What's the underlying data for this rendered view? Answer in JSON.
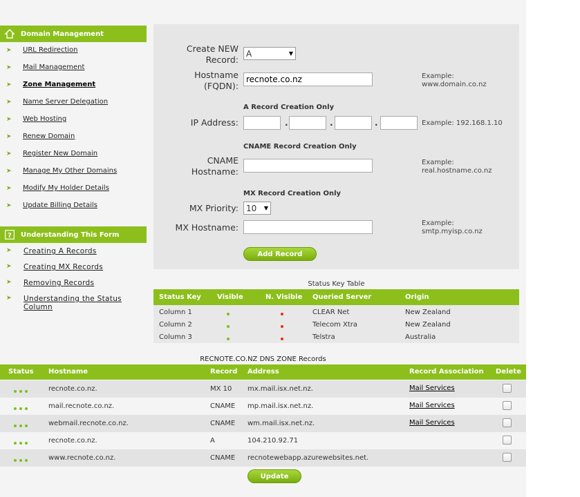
{
  "sidebar": {
    "domain_heading": "Domain Management",
    "nav_items": [
      "URL Redirection",
      "Mail Management",
      "Zone Management",
      "Name Server Delegation",
      "Web Hosting",
      "Renew Domain",
      "Register New Domain",
      "Manage My Other Domains",
      "Modify My Holder Details",
      "Update Billing Details"
    ],
    "help_heading": "Understanding This Form",
    "help_items": [
      "Creating A Records",
      "Creating MX Records",
      "Removing Records",
      "Understanding the Status Column"
    ]
  },
  "form": {
    "create_label_1": "Create NEW",
    "create_label_2": "Record:",
    "record_type": "A",
    "hostname_label_1": "Hostname",
    "hostname_label_2": "(FQDN):",
    "hostname_value": "recnote.co.nz",
    "hostname_example_1": "Example:",
    "hostname_example_2": "www.domain.co.nz",
    "a_section": "A Record Creation Only",
    "ip_label": "IP Address:",
    "ip_octets": [
      "",
      "",
      "",
      ""
    ],
    "ip_dot": ".",
    "ip_example": "Example: 192.168.1.10",
    "cname_section": "CNAME Record Creation Only",
    "cname_label_1": "CNAME",
    "cname_label_2": "Hostname:",
    "cname_value": "",
    "cname_example_1": "Example:",
    "cname_example_2": "real.hostname.co.nz",
    "mx_section": "MX Record Creation Only",
    "mx_priority_label": "MX Priority:",
    "mx_priority_value": "10",
    "mx_hostname_label": "MX Hostname:",
    "mx_hostname_value": "",
    "mx_example_1": "Example:",
    "mx_example_2": "smtp.myisp.co.nz",
    "add_button": "Add Record"
  },
  "status_key": {
    "title": "Status Key Table",
    "headers": [
      "Status Key",
      "Visible",
      "N. Visible",
      "Queried Server",
      "Origin"
    ],
    "rows": [
      {
        "key": "Column 1",
        "server": "CLEAR Net",
        "origin": "New Zealand"
      },
      {
        "key": "Column 2",
        "server": "Telecom Xtra",
        "origin": "New Zealand"
      },
      {
        "key": "Column 3",
        "server": "Telstra",
        "origin": "Australia"
      }
    ],
    "visible_color": "#7cc118",
    "not_visible_color": "#e03010"
  },
  "records": {
    "title": "RECNOTE.CO.NZ DNS ZONE Records",
    "headers": [
      "Status",
      "Hostname",
      "Record",
      "Address",
      "Record Association",
      "Delete"
    ],
    "rows": [
      {
        "hostname": "recnote.co.nz.",
        "record": "MX 10",
        "address": "mx.mail.isx.net.nz.",
        "association": "Mail Services"
      },
      {
        "hostname": "mail.recnote.co.nz.",
        "record": "CNAME",
        "address": "mp.mail.isx.net.nz.",
        "association": "Mail Services"
      },
      {
        "hostname": "webmail.recnote.co.nz.",
        "record": "CNAME",
        "address": "wm.mail.isx.net.nz.",
        "association": "Mail Services"
      },
      {
        "hostname": "recnote.co.nz.",
        "record": "A",
        "address": "104.210.92.71",
        "association": ""
      },
      {
        "hostname": "www.recnote.co.nz.",
        "record": "CNAME",
        "address": "recnotewebapp.azurewebsites.net.",
        "association": ""
      }
    ],
    "update_button": "Update"
  },
  "colors": {
    "accent": "#8cbf1c",
    "panel": "#e6e6e6"
  }
}
